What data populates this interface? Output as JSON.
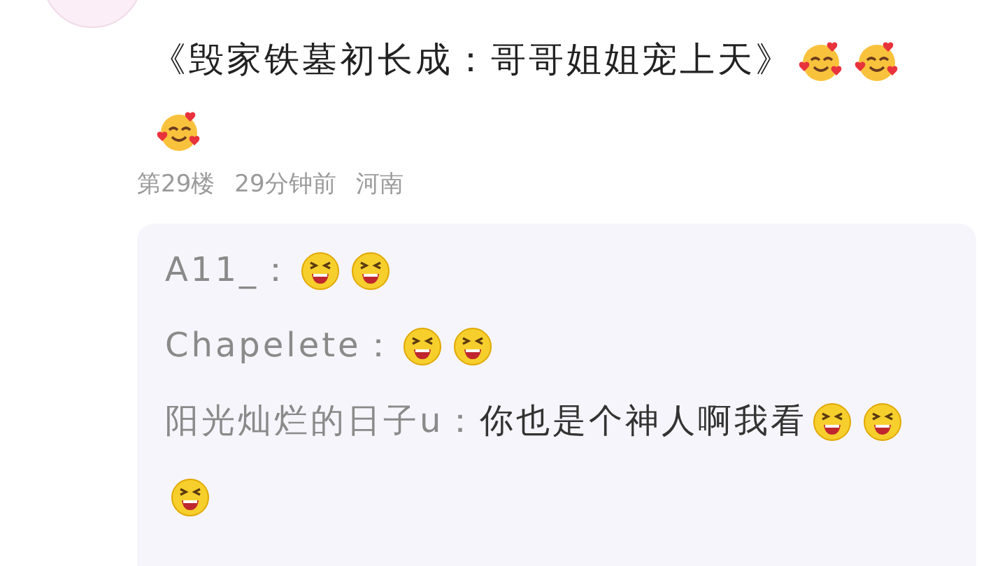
{
  "post": {
    "content": [
      {
        "kind": "text",
        "text": "《毁家铁墓初长成：哥哥姐姐宠上天》"
      },
      {
        "kind": "hearts"
      },
      {
        "kind": "hearts"
      },
      {
        "kind": "hearts"
      }
    ],
    "meta": [
      "第29楼",
      "29分钟前",
      "河南"
    ]
  },
  "replies": [
    {
      "author": "A11_：",
      "content": [
        {
          "kind": "laugh"
        },
        {
          "kind": "laugh"
        }
      ]
    },
    {
      "author": "Chapelete：",
      "content": [
        {
          "kind": "laugh"
        },
        {
          "kind": "laugh"
        }
      ]
    },
    {
      "author": "阳光灿烂的日子u：",
      "content": [
        {
          "kind": "text",
          "text": "你也是个神人啊我看"
        },
        {
          "kind": "laugh"
        },
        {
          "kind": "laugh"
        },
        {
          "kind": "laugh"
        }
      ]
    }
  ]
}
